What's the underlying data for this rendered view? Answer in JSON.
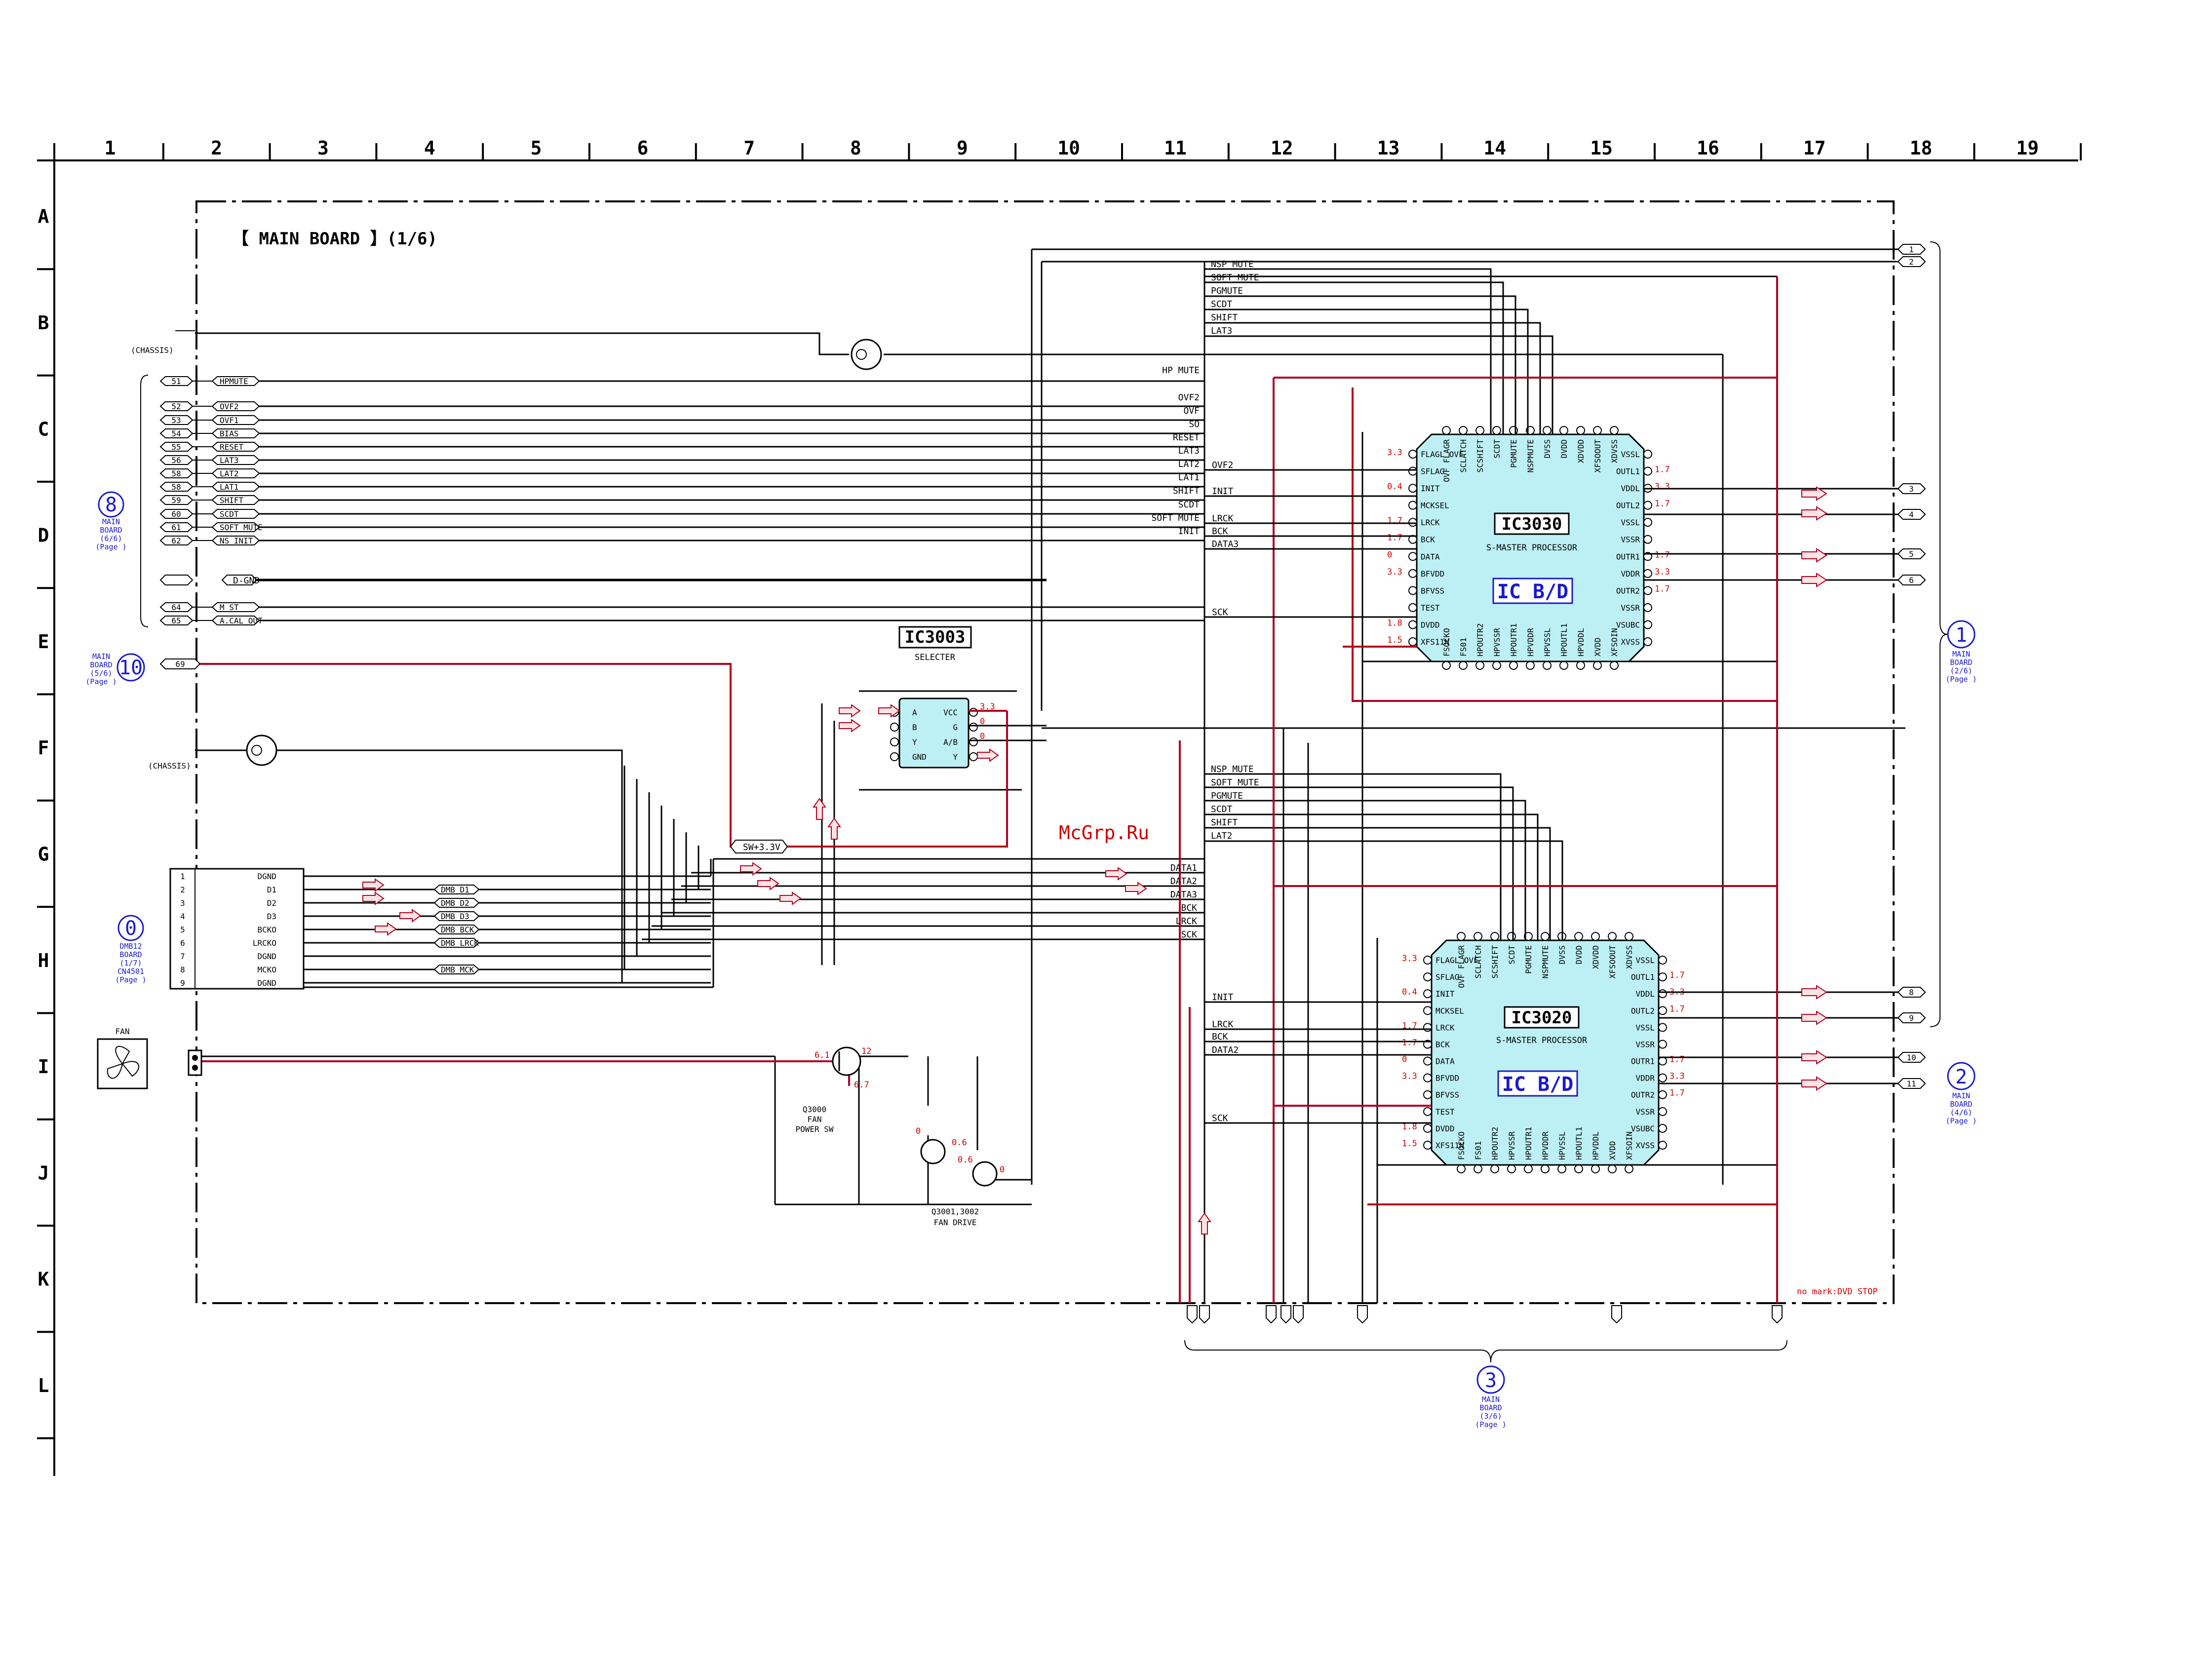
{
  "grid": {
    "columns": [
      "1",
      "2",
      "3",
      "4",
      "5",
      "6",
      "7",
      "8",
      "9",
      "10",
      "11",
      "12",
      "13",
      "14",
      "15",
      "16",
      "17",
      "18",
      "19"
    ],
    "rows": [
      "A",
      "B",
      "C",
      "D",
      "E",
      "F",
      "G",
      "H",
      "I",
      "J",
      "K",
      "L"
    ]
  },
  "sheet_title": "【 MAIN BOARD 】(1/6)",
  "watermark": "McGrp.Ru",
  "note": "no mark:DVD STOP",
  "chassis_label": "(CHASSIS)",
  "fan_label": "FAN",
  "gnd_label": "D-GND",
  "sw_label": "SW+3.3V",
  "ic3030": {
    "name": "IC3030",
    "desc": "S-MASTER PROCESSOR",
    "board_tag": "IC B/D",
    "left_pins": [
      "FLAGL OVF",
      "SFLAG",
      "INIT",
      "MCKSEL",
      "LRCK",
      "BCK",
      "DATA",
      "BFVDD",
      "BFVSS",
      "TEST",
      "DVDD",
      "XFS11N"
    ],
    "left_volts": [
      "3.3",
      "",
      "0.4",
      "",
      "1.7",
      "1.7",
      "0",
      "3.3",
      "",
      "",
      "1.8",
      "1.5"
    ],
    "right_pins": [
      "VSSL",
      "OUTL1",
      "VDDL",
      "OUTL2",
      "VSSL",
      "VSSR",
      "OUTR1",
      "VDDR",
      "OUTR2",
      "VSSR",
      "VSUBC",
      "XVSS"
    ],
    "right_volts": [
      "",
      "1.7",
      "3.3",
      "1.7",
      "",
      "",
      "1.7",
      "3.3",
      "1.7",
      "",
      "",
      ""
    ],
    "top_pins": [
      "OVF FLAGR",
      "SCLATCH",
      "SCSHIFT",
      "SCDT",
      "PGMUTE",
      "NSPMUTE",
      "DVSS",
      "DVDD",
      "XDVDD",
      "XFSOOUT",
      "XDVSS"
    ],
    "bottom_pins": [
      "FSOCKO",
      "FS01",
      "HPOUTR2",
      "HPVSSR",
      "HPOUTR1",
      "HPVDDR",
      "HPVSSL",
      "HPOUTL1",
      "HPVDDL",
      "XVDD",
      "XFSOIN"
    ]
  },
  "ic3020": {
    "name": "IC3020",
    "desc": "S-MASTER PROCESSOR",
    "board_tag": "IC B/D",
    "left_pins": [
      "FLAGL OVF",
      "SFLAG",
      "INIT",
      "MCKSEL",
      "LRCK",
      "BCK",
      "DATA",
      "BFVDD",
      "BFVSS",
      "TEST",
      "DVDD",
      "XFS11N"
    ],
    "left_volts": [
      "3.3",
      "",
      "0.4",
      "",
      "1.7",
      "1.7",
      "0",
      "3.3",
      "",
      "",
      "1.8",
      "1.5"
    ],
    "right_pins": [
      "VSSL",
      "OUTL1",
      "VDDL",
      "OUTL2",
      "VSSL",
      "VSSR",
      "OUTR1",
      "VDDR",
      "OUTR2",
      "VSSR",
      "VSUBC",
      "XVSS"
    ],
    "right_volts": [
      "",
      "1.7",
      "3.3",
      "1.7",
      "",
      "",
      "1.7",
      "3.3",
      "1.7",
      "",
      "",
      ""
    ],
    "top_pins": [
      "OVF FLAGR",
      "SCLATCH",
      "SCSHIFT",
      "SCDT",
      "PGMUTE",
      "NSPMUTE",
      "DVSS",
      "DVDD",
      "XDVDD",
      "XFSOOUT",
      "XDVSS"
    ],
    "bottom_pins": [
      "FSOCKO",
      "FS01",
      "HPOUTR2",
      "HPVSSR",
      "HPOUTR1",
      "HPVDDR",
      "HPVSSL",
      "HPOUTL1",
      "HPVDDL",
      "XVDD",
      "XFSOIN"
    ]
  },
  "ic3003": {
    "name": "IC3003",
    "desc": "SELECTER",
    "left_pins": [
      "A",
      "B",
      "Y",
      "GND"
    ],
    "right_pins": [
      "VCC",
      "G",
      "A/B",
      "Y"
    ],
    "volts": [
      "3.3",
      "0",
      "0"
    ]
  },
  "connector8": {
    "ref": "8",
    "label": [
      "MAIN",
      "BOARD",
      "(6/6)",
      "(Page    )"
    ],
    "pins": [
      {
        "n": "51",
        "s": "HPMUTE"
      },
      {
        "n": "52",
        "s": "OVF2"
      },
      {
        "n": "53",
        "s": "OVF1"
      },
      {
        "n": "54",
        "s": "BIAS"
      },
      {
        "n": "55",
        "s": "RESET"
      },
      {
        "n": "56",
        "s": "LAT3"
      },
      {
        "n": "58",
        "s": "LAT2"
      },
      {
        "n": "58",
        "s": "LAT1"
      },
      {
        "n": "59",
        "s": "SHIFT"
      },
      {
        "n": "60",
        "s": "SCDT"
      },
      {
        "n": "61",
        "s": "SOFT_MUTE"
      },
      {
        "n": "62",
        "s": "NS_INIT"
      },
      {
        "n": "63",
        "s": ""
      },
      {
        "n": "64",
        "s": "M_ST"
      },
      {
        "n": "65",
        "s": "A.CAL OUT"
      }
    ]
  },
  "connector10": {
    "ref": "10",
    "label": [
      "MAIN",
      "BOARD",
      "(5/6)",
      "(Page    )"
    ],
    "pin": "69"
  },
  "connector0": {
    "ref": "0",
    "label": [
      "DMB12",
      "BOARD",
      "(1/7)",
      "CN4501",
      "(Page    )"
    ],
    "pins": [
      {
        "n": "1",
        "s": "DGND"
      },
      {
        "n": "2",
        "s": "D1"
      },
      {
        "n": "3",
        "s": "D2"
      },
      {
        "n": "4",
        "s": "D3"
      },
      {
        "n": "5",
        "s": "BCKO"
      },
      {
        "n": "6",
        "s": "LRCKO"
      },
      {
        "n": "7",
        "s": "DGND"
      },
      {
        "n": "8",
        "s": "MCKO"
      },
      {
        "n": "9",
        "s": "DGND"
      }
    ],
    "net_labels": [
      "DMB_D1",
      "DMB_D2",
      "DMB_D3",
      "DMB_BCK",
      "DMB_LRCK",
      "DMB_MCK"
    ]
  },
  "right_bus_labels": [
    "HP MUTE",
    "OVF2",
    "OVF",
    "SO",
    "RESET",
    "LAT3",
    "LAT2",
    "LAT1",
    "SHIFT",
    "SCDT",
    "SOFT MUTE",
    "INIT"
  ],
  "upper_bus_labels": [
    "NSP MUTE",
    "SOFT MUTE",
    "PGMUTE",
    "SCDT",
    "SHIFT",
    "LAT3"
  ],
  "lower_bus_labels": [
    "NSP MUTE",
    "SOFT MUTE",
    "PGMUTE",
    "SCDT",
    "SHIFT",
    "LAT2"
  ],
  "data_bus_labels": [
    "DATA1",
    "DATA2",
    "DATA3",
    "BCK",
    "LRCK",
    "SCK"
  ],
  "ic3030_in_labels": [
    "OVF2",
    "INIT",
    "LRCK",
    "BCK",
    "DATA3",
    "SCK"
  ],
  "ic3020_in_labels": [
    "INIT",
    "LRCK",
    "BCK",
    "DATA2",
    "SCK"
  ],
  "ref1": {
    "ref": "1",
    "label": [
      "MAIN",
      "BOARD",
      "(2/6)",
      "(Page    )"
    ]
  },
  "ref2": {
    "ref": "2",
    "label": [
      "MAIN",
      "BOARD",
      "(4/6)",
      "(Page    )"
    ]
  },
  "ref3": {
    "ref": "3",
    "label": [
      "MAIN",
      "BOARD",
      "(3/6)",
      "(Page    )"
    ]
  },
  "q3000": {
    "name": "Q3000",
    "desc": [
      "FAN",
      "POWER SW"
    ],
    "volts": [
      "6.1",
      "12",
      "6.7"
    ]
  },
  "q3001": {
    "name": "Q3001,3002",
    "desc": "FAN DRIVE",
    "volts": [
      "0",
      "0.6",
      "0.6",
      "0"
    ]
  }
}
